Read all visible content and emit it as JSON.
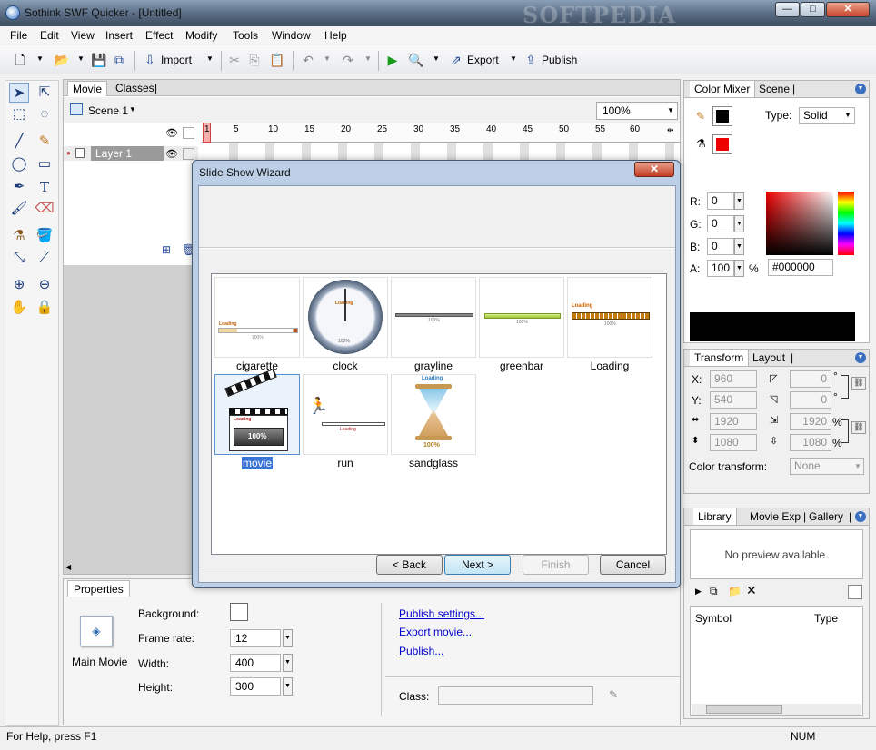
{
  "window": {
    "title": "Sothink SWF Quicker - [Untitled]",
    "watermark": "SOFTPEDIA"
  },
  "menu": [
    "File",
    "Edit",
    "View",
    "Insert",
    "Effect",
    "Modify",
    "Tools",
    "Window",
    "Help"
  ],
  "toolbar": {
    "import_label": "Import",
    "export_label": "Export",
    "publish_label": "Publish"
  },
  "movie_panel": {
    "tabs": [
      "Movie",
      "Classes"
    ],
    "scene_label": "Scene 1",
    "zoom": "100%",
    "layer_name": "Layer 1",
    "ruler": [
      "1",
      "5",
      "10",
      "15",
      "20",
      "25",
      "30",
      "35",
      "40",
      "45",
      "50",
      "55",
      "60"
    ]
  },
  "properties": {
    "tab": "Properties",
    "main_movie": "Main Movie",
    "background_label": "Background:",
    "frame_rate_label": "Frame rate:",
    "frame_rate": "12",
    "width_label": "Width:",
    "width": "400",
    "height_label": "Height:",
    "height": "300",
    "publish_settings": "Publish settings...",
    "export_movie": "Export movie...",
    "publish": "Publish...",
    "class_label": "Class:"
  },
  "color_mixer": {
    "tabs": [
      "Color Mixer",
      "Scene"
    ],
    "type_label": "Type:",
    "type_value": "Solid",
    "r_label": "R:",
    "r": "0",
    "g_label": "G:",
    "g": "0",
    "b_label": "B:",
    "b": "0",
    "a_label": "A:",
    "a": "100",
    "percent": "%",
    "hex": "#000000",
    "stroke_color": "#000000",
    "fill_color": "#ff0000"
  },
  "transform": {
    "tabs": [
      "Transform",
      "Layout"
    ],
    "x_label": "X:",
    "x": "960",
    "y_label": "Y:",
    "y": "540",
    "w": "1920",
    "h": "1080",
    "skew1": "0",
    "skew2": "0",
    "scale_w": "1920",
    "scale_h": "1080",
    "deg": "°",
    "pct": "%",
    "color_transform_label": "Color transform:",
    "color_transform": "None"
  },
  "library": {
    "tabs": [
      "Library",
      "Movie Exp",
      "Gallery"
    ],
    "preview": "No preview available.",
    "col_symbol": "Symbol",
    "col_type": "Type"
  },
  "status": {
    "help": "For Help, press F1",
    "num": "NUM"
  },
  "dialog": {
    "title": "Slide Show Wizard",
    "close": "✕",
    "items": [
      {
        "label": "cigarette"
      },
      {
        "label": "clock"
      },
      {
        "label": "grayline"
      },
      {
        "label": "greenbar"
      },
      {
        "label": "Loading"
      },
      {
        "label": "movie",
        "selected": true
      },
      {
        "label": "run"
      },
      {
        "label": "sandglass"
      }
    ],
    "thumb_text": {
      "loading": "Loading",
      "pct": "100%"
    },
    "buttons": {
      "back": "< Back",
      "next": "Next >",
      "finish": "Finish",
      "cancel": "Cancel"
    }
  }
}
